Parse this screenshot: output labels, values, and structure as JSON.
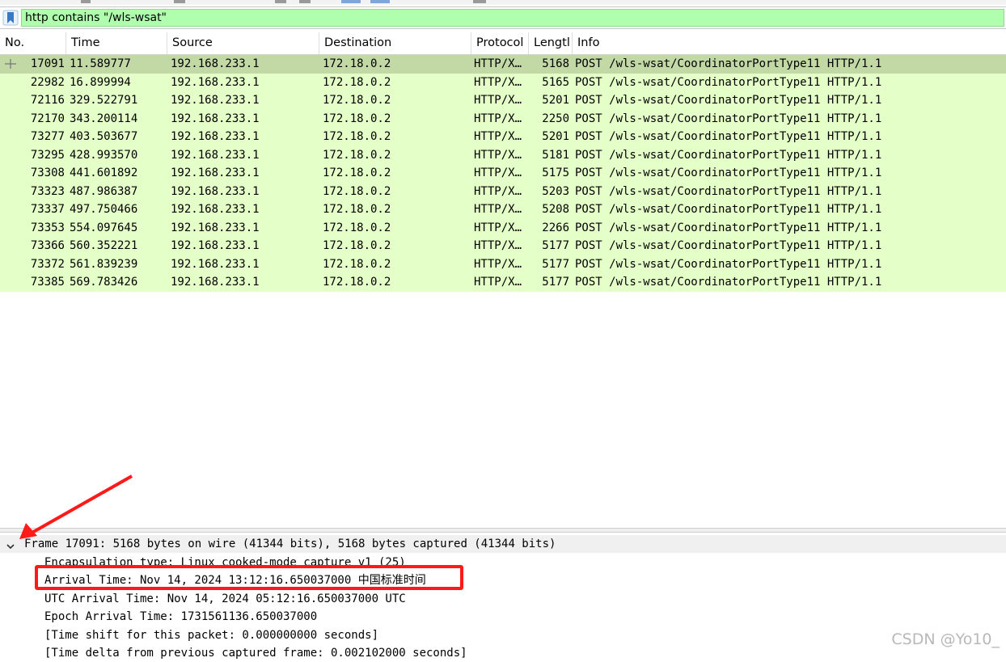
{
  "filter": {
    "value": "http contains \"/wls-wsat\""
  },
  "columns": [
    "No.",
    "Time",
    "Source",
    "Destination",
    "Protocol",
    "Lengtl",
    "Info"
  ],
  "packets": [
    {
      "no": "17091",
      "time": "11.589777",
      "src": "192.168.233.1",
      "dst": "172.18.0.2",
      "proto": "HTTP/X…",
      "len": "5168",
      "info": "POST /wls-wsat/CoordinatorPortType11 HTTP/1.1"
    },
    {
      "no": "22982",
      "time": "16.899994",
      "src": "192.168.233.1",
      "dst": "172.18.0.2",
      "proto": "HTTP/X…",
      "len": "5165",
      "info": "POST /wls-wsat/CoordinatorPortType11 HTTP/1.1"
    },
    {
      "no": "72116",
      "time": "329.522791",
      "src": "192.168.233.1",
      "dst": "172.18.0.2",
      "proto": "HTTP/X…",
      "len": "5201",
      "info": "POST /wls-wsat/CoordinatorPortType11 HTTP/1.1"
    },
    {
      "no": "72170",
      "time": "343.200114",
      "src": "192.168.233.1",
      "dst": "172.18.0.2",
      "proto": "HTTP/X…",
      "len": "2250",
      "info": "POST /wls-wsat/CoordinatorPortType11 HTTP/1.1"
    },
    {
      "no": "73277",
      "time": "403.503677",
      "src": "192.168.233.1",
      "dst": "172.18.0.2",
      "proto": "HTTP/X…",
      "len": "5201",
      "info": "POST /wls-wsat/CoordinatorPortType11 HTTP/1.1"
    },
    {
      "no": "73295",
      "time": "428.993570",
      "src": "192.168.233.1",
      "dst": "172.18.0.2",
      "proto": "HTTP/X…",
      "len": "5181",
      "info": "POST /wls-wsat/CoordinatorPortType11 HTTP/1.1"
    },
    {
      "no": "73308",
      "time": "441.601892",
      "src": "192.168.233.1",
      "dst": "172.18.0.2",
      "proto": "HTTP/X…",
      "len": "5175",
      "info": "POST /wls-wsat/CoordinatorPortType11 HTTP/1.1"
    },
    {
      "no": "73323",
      "time": "487.986387",
      "src": "192.168.233.1",
      "dst": "172.18.0.2",
      "proto": "HTTP/X…",
      "len": "5203",
      "info": "POST /wls-wsat/CoordinatorPortType11 HTTP/1.1"
    },
    {
      "no": "73337",
      "time": "497.750466",
      "src": "192.168.233.1",
      "dst": "172.18.0.2",
      "proto": "HTTP/X…",
      "len": "5208",
      "info": "POST /wls-wsat/CoordinatorPortType11 HTTP/1.1"
    },
    {
      "no": "73353",
      "time": "554.097645",
      "src": "192.168.233.1",
      "dst": "172.18.0.2",
      "proto": "HTTP/X…",
      "len": "2266",
      "info": "POST /wls-wsat/CoordinatorPortType11 HTTP/1.1"
    },
    {
      "no": "73366",
      "time": "560.352221",
      "src": "192.168.233.1",
      "dst": "172.18.0.2",
      "proto": "HTTP/X…",
      "len": "5177",
      "info": "POST /wls-wsat/CoordinatorPortType11 HTTP/1.1"
    },
    {
      "no": "73372",
      "time": "561.839239",
      "src": "192.168.233.1",
      "dst": "172.18.0.2",
      "proto": "HTTP/X…",
      "len": "5177",
      "info": "POST /wls-wsat/CoordinatorPortType11 HTTP/1.1"
    },
    {
      "no": "73385",
      "time": "569.783426",
      "src": "192.168.233.1",
      "dst": "172.18.0.2",
      "proto": "HTTP/X…",
      "len": "5177",
      "info": "POST /wls-wsat/CoordinatorPortType11 HTTP/1.1"
    }
  ],
  "details": {
    "frame": "Frame 17091: 5168 bytes on wire (41344 bits), 5168 bytes captured (41344 bits)",
    "lines": [
      "Encapsulation type: Linux cooked-mode capture v1 (25)",
      "Arrival Time: Nov 14, 2024 13:12:16.650037000 中国标准时间",
      "UTC Arrival Time: Nov 14, 2024 05:12:16.650037000 UTC",
      "Epoch Arrival Time: 1731561136.650037000",
      "[Time shift for this packet: 0.000000000 seconds]",
      "[Time delta from previous captured frame: 0.002102000 seconds]"
    ]
  },
  "watermark": "CSDN @Yo10_",
  "colors": {
    "filter_valid_bg": "#afffaf",
    "row_http_bg": "#e4ffc7",
    "row_selected_bg": "#c2d9a6",
    "annotation_red": "#ff1a1a"
  },
  "icons": {
    "bookmark": "bookmark-icon",
    "expander": "chevron-down-icon",
    "selected_marker": "related-packet-icon"
  }
}
